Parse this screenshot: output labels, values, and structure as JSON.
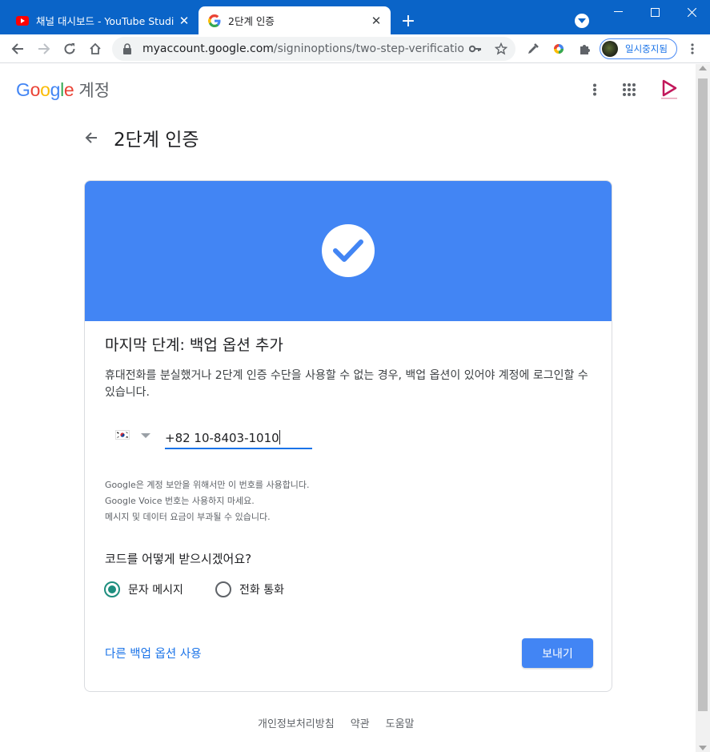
{
  "browser": {
    "tabs": [
      {
        "title": "채널 대시보드 - YouTube Studio",
        "favicon": "youtube-icon",
        "active": false
      },
      {
        "title": "2단계 인증",
        "favicon": "google-g-icon",
        "active": true
      }
    ],
    "url_host": "myaccount.google.com",
    "url_path": "/signinoptions/two-step-verification/...",
    "profile_label": "일시중지됨"
  },
  "header": {
    "logo_letters": [
      "G",
      "o",
      "o",
      "g",
      "l",
      "e"
    ],
    "product": "계정"
  },
  "page": {
    "title": "2단계 인증",
    "card": {
      "heading": "마지막 단계: 백업 옵션 추가",
      "description": "휴대전화를 분실했거나 2단계 인증 수단을 사용할 수 없는 경우, 백업 옵션이 있어야 계정에 로그인할 수 있습니다.",
      "phone_value": "+82 10-8403-1010",
      "notes": [
        "Google은 계정 보안을 위해서만 이 번호를 사용합니다.",
        "Google Voice 번호는 사용하지 마세요.",
        "메시지 및 데이터 요금이 부과될 수 있습니다."
      ],
      "question": "코드를 어떻게 받으시겠어요?",
      "options": [
        {
          "label": "문자 메시지",
          "selected": true
        },
        {
          "label": "전화 통화",
          "selected": false
        }
      ],
      "alt_link": "다른 백업 옵션 사용",
      "send_button": "보내기"
    }
  },
  "footer": [
    "개인정보처리방침",
    "약관",
    "도움말"
  ],
  "colors": {
    "hero": "#4285f4",
    "link": "#1a73e8",
    "radio": "#1e8e7e",
    "tabbar": "#0a64c8"
  }
}
